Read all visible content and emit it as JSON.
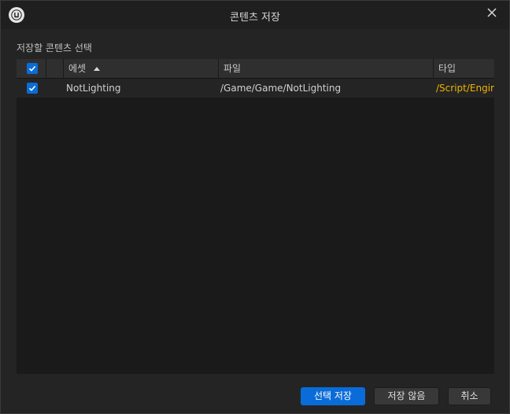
{
  "window": {
    "title": "콘텐츠 저장"
  },
  "section_label": "저장할 콘텐츠 선택",
  "table": {
    "columns": [
      "에셋",
      "파일",
      "타입"
    ],
    "rows": [
      {
        "checked": true,
        "asset": "NotLighting",
        "file": "/Game/Game/NotLighting",
        "type": "/Script/Engir"
      }
    ]
  },
  "buttons": {
    "save_selected": "선택 저장",
    "dont_save": "저장 않음",
    "cancel": "취소"
  },
  "colors": {
    "accent": "#0a6cd8",
    "type_text": "#f0b400"
  },
  "icons": {
    "logo": "unreal-logo-icon",
    "close": "close-icon",
    "sort": "sort-ascending-icon",
    "check": "check-icon"
  }
}
